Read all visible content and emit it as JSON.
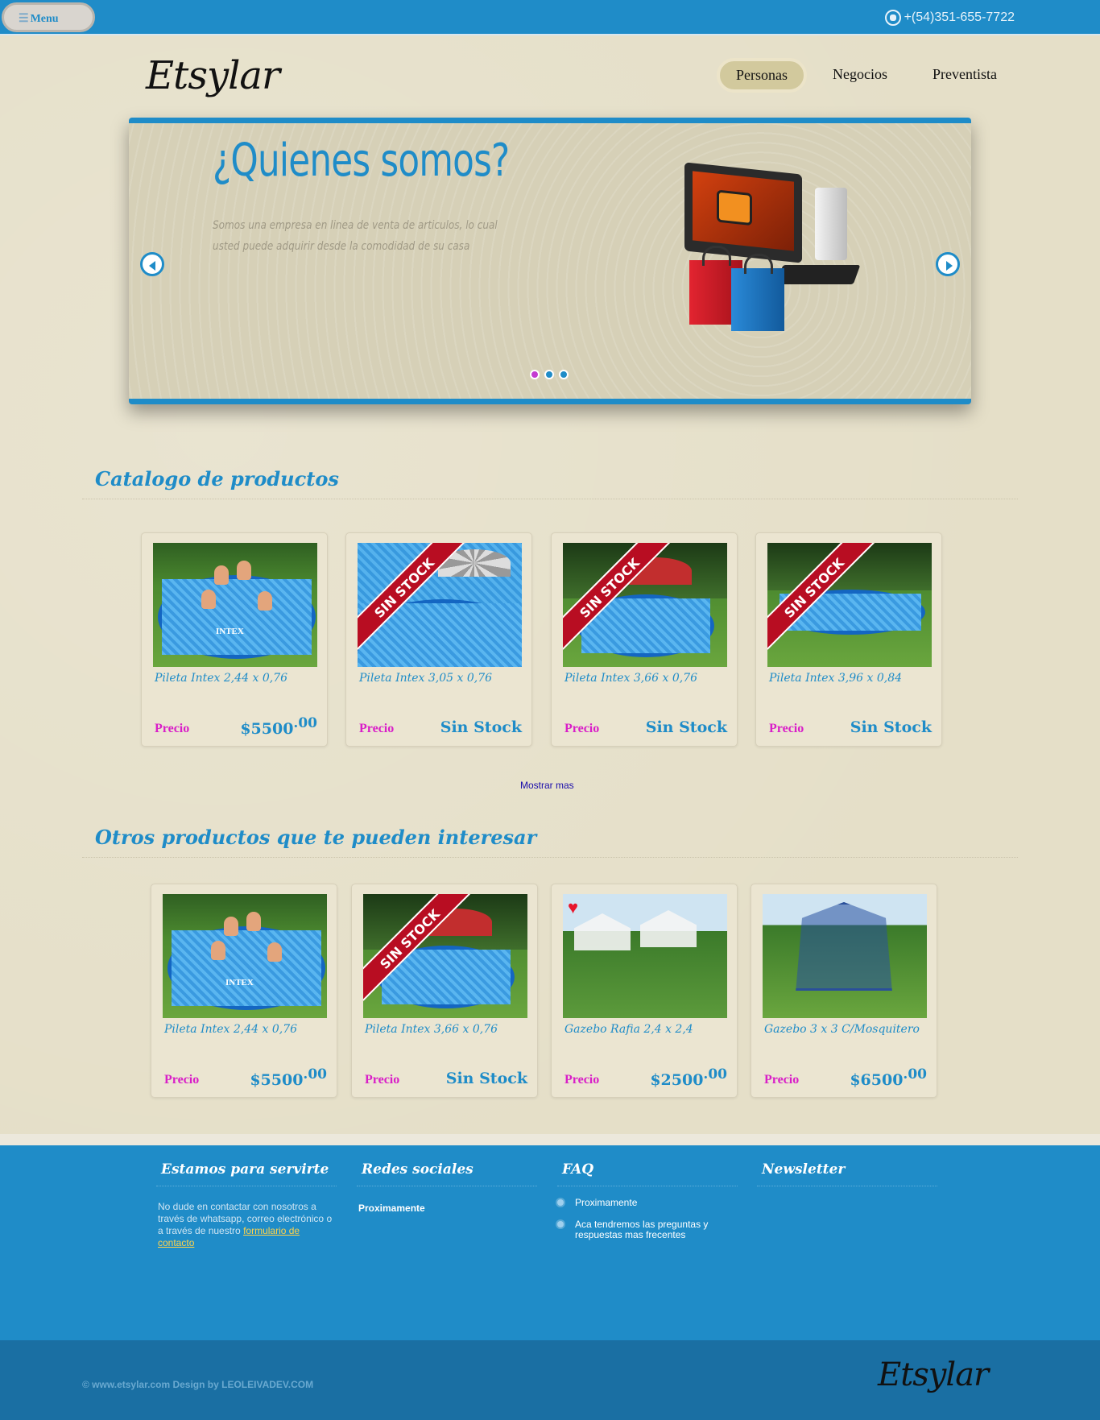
{
  "topbar": {
    "menu_label": "Menu",
    "phone": "+(54)351-655-7722"
  },
  "header": {
    "logo": "Etsylar",
    "nav": [
      {
        "label": "Personas",
        "active": true
      },
      {
        "label": "Negocios",
        "active": false
      },
      {
        "label": "Preventista",
        "active": false
      }
    ]
  },
  "slider": {
    "title": "¿Quienes somos?",
    "text": "Somos una empresa en linea de venta de articulos, lo cual usted puede adquirir desde la comodidad de su casa",
    "dots": 3,
    "active_dot": 0
  },
  "catalog": {
    "title": "Catalogo de productos",
    "precio_label": "Precio",
    "items": [
      {
        "name": "Pileta Intex 2,44 x 0,76",
        "price_main": "$5500",
        "price_cents": ".00",
        "sin_stock": false,
        "image": "pool-family-icon"
      },
      {
        "name": "Pileta Intex 3,05 x 0,76",
        "price_text": "Sin Stock",
        "sin_stock": true,
        "ribbon": "SIN STOCK",
        "image": "pool-umbrella-icon"
      },
      {
        "name": "Pileta Intex 3,66 x 0,76",
        "price_text": "Sin Stock",
        "sin_stock": true,
        "ribbon": "SIN STOCK",
        "image": "pool-garden-icon"
      },
      {
        "name": "Pileta Intex 3,96 x 0,84",
        "price_text": "Sin Stock",
        "sin_stock": true,
        "ribbon": "SIN STOCK",
        "image": "pool-wide-icon"
      }
    ],
    "more_link": "Mostrar mas"
  },
  "others": {
    "title": "Otros productos que te pueden interesar",
    "precio_label": "Precio",
    "items": [
      {
        "name": "Pileta Intex 2,44 x 0,76",
        "price_main": "$5500",
        "price_cents": ".00",
        "sin_stock": false
      },
      {
        "name": "Pileta Intex 3,66 x 0,76",
        "price_text": "Sin Stock",
        "sin_stock": true,
        "ribbon": "SIN STOCK"
      },
      {
        "name": "Gazebo Rafia 2,4 x 2,4",
        "price_main": "$2500",
        "price_cents": ".00",
        "sin_stock": false
      },
      {
        "name": "Gazebo 3 x 3 C/Mosquitero",
        "price_main": "$6500",
        "price_cents": ".00",
        "sin_stock": false
      }
    ]
  },
  "footer": {
    "col1": {
      "title": "Estamos para servirte",
      "text": "No dude en contactar con nosotros a través de whatsapp, correo electrónico o a través de nuestro ",
      "link": "formulario de contacto"
    },
    "col2": {
      "title": "Redes sociales",
      "text": "Proximamente"
    },
    "col3": {
      "title": "FAQ",
      "items": [
        "Proximamente",
        "Aca tendremos las preguntas y respuestas mas frecentes"
      ]
    },
    "col4": {
      "title": "Newsletter"
    },
    "copyright": "© www.etsylar.com Design by LEOLEIVADEV.COM",
    "logo": "Etsylar"
  },
  "colors": {
    "brand_blue": "#1f8cc8",
    "price_label_magenta": "#d91ec8",
    "background": "#e5dfc8"
  }
}
